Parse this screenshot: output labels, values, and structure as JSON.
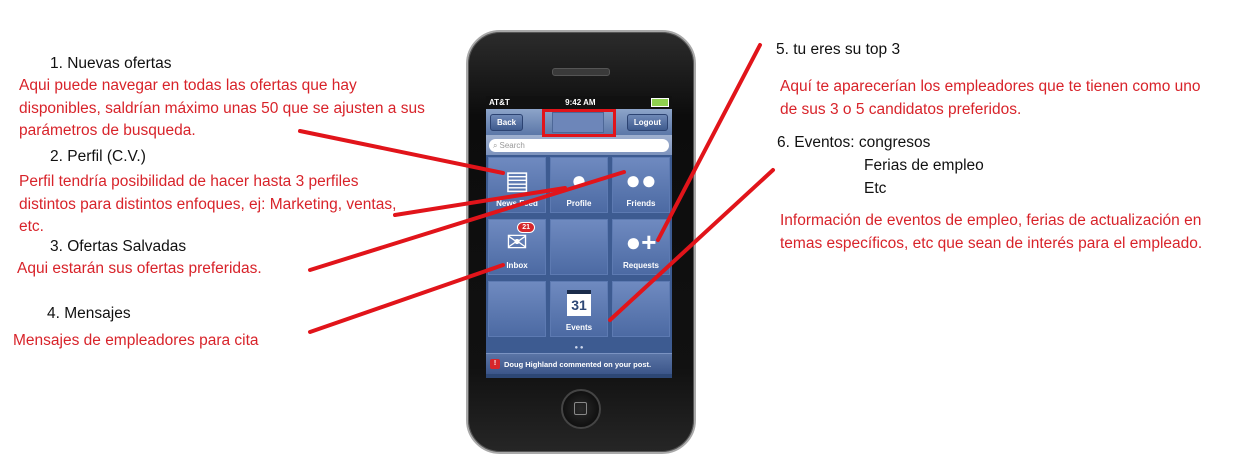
{
  "annotations": {
    "n1": {
      "title": "1. Nuevas ofertas",
      "body": "Aqui puede navegar en todas las ofertas que hay disponibles, saldrían máximo unas 50 que se ajusten a sus parámetros de busqueda."
    },
    "n2": {
      "title": "2. Perfil (C.V.)",
      "body": "Perfil tendría posibilidad de hacer hasta 3 perfiles distintos para distintos enfoques, ej: Marketing, ventas, etc."
    },
    "n3": {
      "title": "3. Ofertas Salvadas",
      "body": "Aqui estarán sus ofertas preferidas."
    },
    "n4": {
      "title": "4. Mensajes",
      "body": "Mensajes de empleadores para cita"
    },
    "n5": {
      "title": "5. tu eres su top 3",
      "body": "Aquí te aparecerían los empleadores que te tienen como uno de sus 3 o 5 candidatos preferidos."
    },
    "n6": {
      "title": "6. Eventos: congresos",
      "sub1": "Ferias de empleo",
      "sub2": "Etc",
      "body": "Información de eventos de empleo, ferias de actualización en temas específicos, etc que sean de interés para el empleado."
    }
  },
  "phone": {
    "status": {
      "carrier": "AT&T",
      "time": "9:42 AM"
    },
    "nav": {
      "back_label": "Back",
      "logout_label": "Logout"
    },
    "search": {
      "placeholder": "Search"
    },
    "tiles": {
      "news_feed": "News Feed",
      "profile": "Profile",
      "friends": "Friends",
      "inbox": "Inbox",
      "inbox_badge": "21",
      "requests": "Requests",
      "events": "Events",
      "events_day": "31"
    },
    "notification": "Doug Highland commented on your post."
  },
  "colors": {
    "annotation_red": "#d8232a",
    "line_red": "#e1141a",
    "phone_blue": "#3d5b91"
  }
}
